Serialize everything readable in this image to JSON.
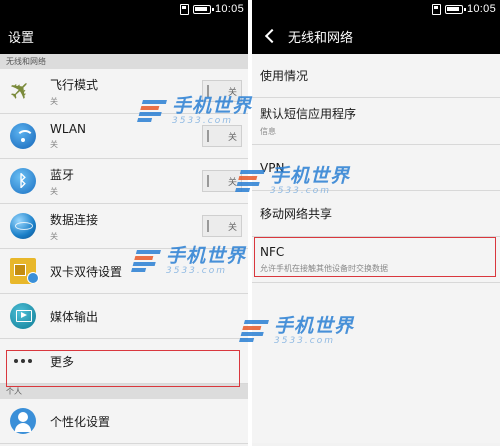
{
  "status_bar": {
    "time": "10:05"
  },
  "left": {
    "title": "设置",
    "section_wireless": "无线和网络",
    "section_personal": "个人",
    "items": [
      {
        "title": "飞行模式",
        "sub": "关",
        "toggle": "关"
      },
      {
        "title": "WLAN",
        "sub": "关",
        "toggle": "关"
      },
      {
        "title": "蓝牙",
        "sub": "关",
        "toggle": "关"
      },
      {
        "title": "数据连接",
        "sub": "关",
        "toggle": "关"
      },
      {
        "title": "双卡双待设置"
      },
      {
        "title": "媒体输出"
      },
      {
        "title": "更多"
      }
    ],
    "personal_items": [
      {
        "title": "个性化设置"
      }
    ]
  },
  "right": {
    "title": "无线和网络",
    "items": [
      {
        "title": "使用情况"
      },
      {
        "title": "默认短信应用程序",
        "sub": "信息"
      },
      {
        "title": "VPN"
      },
      {
        "title": "移动网络共享"
      },
      {
        "title": "NFC",
        "sub": "允许手机在接触其他设备时交换数据"
      }
    ]
  },
  "watermark": {
    "name": "手机世界",
    "domain": "3533.com"
  },
  "colors": {
    "highlight": "#d9373d",
    "bar": "#000000"
  }
}
